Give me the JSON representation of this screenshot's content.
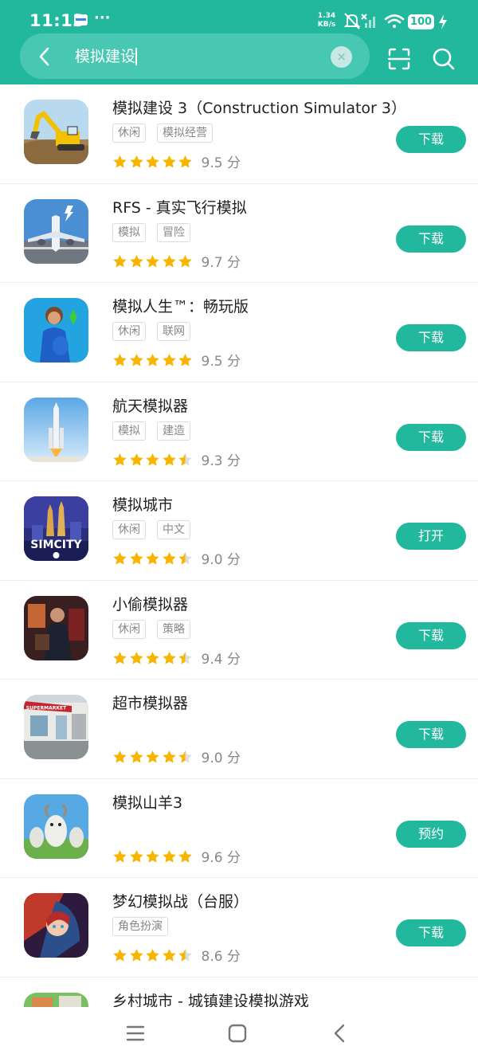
{
  "status_bar": {
    "time": "11:13",
    "dots": "···",
    "speed_value": "1.34",
    "speed_unit": "KB/s",
    "battery": "100"
  },
  "search": {
    "query": "模拟建设",
    "clear_label": "×"
  },
  "colors": {
    "accent": "#21b89e",
    "star": "#f7b500",
    "star_empty": "#dddddd"
  },
  "apps": [
    {
      "name": "模拟建设 3（Construction Simulator 3）",
      "tags": [
        "休闲",
        "模拟经营"
      ],
      "stars": 5,
      "score": "9.5 分",
      "action": "下载",
      "icon": "excavator-icon"
    },
    {
      "name": "RFS - 真实飞行模拟",
      "tags": [
        "模拟",
        "冒险"
      ],
      "stars": 5,
      "score": "9.7 分",
      "action": "下载",
      "icon": "airplane-icon"
    },
    {
      "name": "模拟人生™：畅玩版",
      "tags": [
        "休闲",
        "联网"
      ],
      "stars": 5,
      "score": "9.5 分",
      "action": "下载",
      "icon": "sims-icon"
    },
    {
      "name": "航天模拟器",
      "tags": [
        "模拟",
        "建造"
      ],
      "stars": 4.5,
      "score": "9.3 分",
      "action": "下载",
      "icon": "rocket-icon"
    },
    {
      "name": "模拟城市",
      "tags": [
        "休闲",
        "中文"
      ],
      "stars": 4.5,
      "score": "9.0 分",
      "action": "打开",
      "icon": "simcity-icon"
    },
    {
      "name": "小偷模拟器",
      "tags": [
        "休闲",
        "策略"
      ],
      "stars": 4.5,
      "score": "9.4 分",
      "action": "下载",
      "icon": "thief-icon"
    },
    {
      "name": "超市模拟器",
      "tags": [],
      "stars": 4.5,
      "score": "9.0 分",
      "action": "下载",
      "icon": "supermarket-icon"
    },
    {
      "name": "模拟山羊3",
      "tags": [],
      "stars": 5,
      "score": "9.6 分",
      "action": "预约",
      "icon": "goat-icon"
    },
    {
      "name": "梦幻模拟战（台服）",
      "tags": [
        "角色扮演"
      ],
      "stars": 4.5,
      "score": "8.6 分",
      "action": "下载",
      "icon": "langrisser-icon"
    },
    {
      "name": "乡村城市 - 城镇建设模拟游戏",
      "tags": [],
      "stars": 0,
      "score": "",
      "action": "",
      "icon": "village-city-icon"
    }
  ],
  "simcity_logo": "SIMCITY",
  "supermarket_sign": "SUPERMARKET"
}
